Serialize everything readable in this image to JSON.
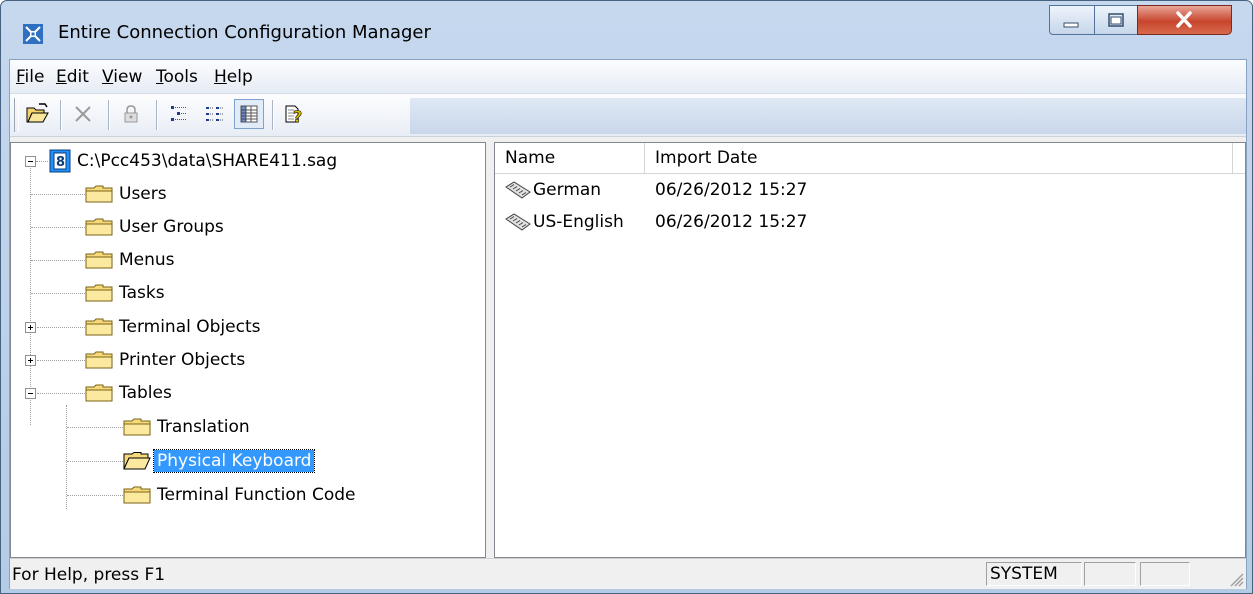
{
  "window": {
    "title": "Entire Connection Configuration Manager",
    "accent": "#3399ff"
  },
  "menu": {
    "items": [
      {
        "label_u": "F",
        "label_rest": "ile"
      },
      {
        "label_u": "E",
        "label_rest": "dit"
      },
      {
        "label_u": "V",
        "label_rest": "iew"
      },
      {
        "label_u": "T",
        "label_rest": "ools"
      },
      {
        "label_u": "H",
        "label_rest": "elp"
      }
    ]
  },
  "toolbar": {
    "icons": [
      "open-folder-icon",
      "delete-icon",
      "lock-icon",
      "tree-view-icon",
      "list-view-icon",
      "details-view-icon",
      "help-icon"
    ]
  },
  "tree": {
    "root": "C:\\Pcc453\\data\\SHARE411.sag",
    "items": [
      {
        "label": "Users"
      },
      {
        "label": "User Groups"
      },
      {
        "label": "Menus"
      },
      {
        "label": "Tasks"
      },
      {
        "label": "Terminal Objects"
      },
      {
        "label": "Printer Objects"
      },
      {
        "label": "Tables"
      }
    ],
    "tables_children": [
      {
        "label": "Translation"
      },
      {
        "label": "Physical Keyboard",
        "selected": true
      },
      {
        "label": "Terminal Function Code"
      }
    ]
  },
  "list": {
    "columns": [
      "Name",
      "Import Date"
    ],
    "rows": [
      {
        "name": "German",
        "import_date": "06/26/2012 15:27"
      },
      {
        "name": "US-English",
        "import_date": "06/26/2012 15:27"
      }
    ]
  },
  "status": {
    "text": "For Help, press F1",
    "panels": [
      "SYSTEM",
      "",
      ""
    ]
  }
}
